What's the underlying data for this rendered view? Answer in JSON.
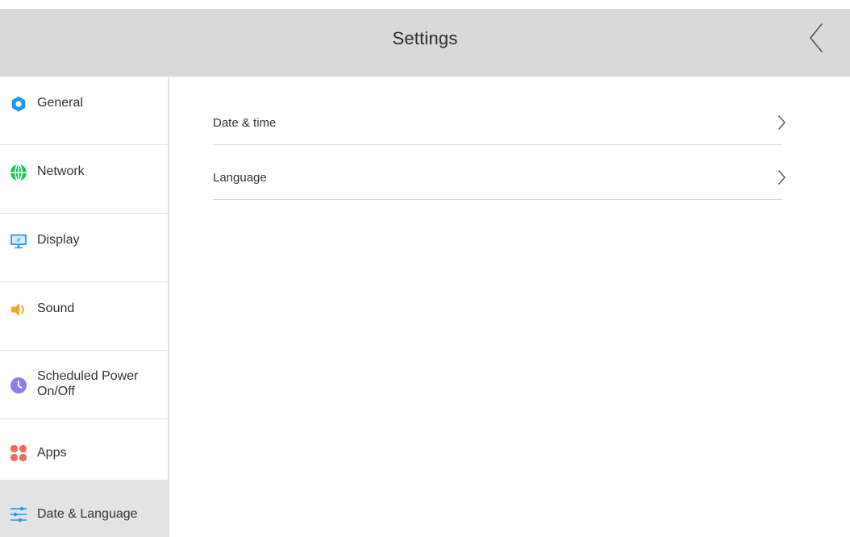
{
  "header": {
    "title": "Settings",
    "back_icon": "chevron-left-icon"
  },
  "sidebar": {
    "items": [
      {
        "label": "General",
        "icon": "gear-icon",
        "color": "#2196f3",
        "active": false
      },
      {
        "label": "Network",
        "icon": "globe-icon",
        "color": "#1ec25a",
        "active": false
      },
      {
        "label": "Display",
        "icon": "monitor-icon",
        "color": "#3aa0ea",
        "active": false
      },
      {
        "label": "Sound",
        "icon": "speaker-icon",
        "color": "#f5a623",
        "active": false
      },
      {
        "label": "Scheduled Power\nOn/Off",
        "icon": "clock-icon",
        "color": "#8f7cf0",
        "active": false
      },
      {
        "label": "Apps",
        "icon": "apps-icon",
        "color": "#f56a5b",
        "active": false
      },
      {
        "label": "Date & Language",
        "icon": "sliders-icon",
        "color": "#2196f3",
        "active": true
      }
    ]
  },
  "main": {
    "rows": [
      {
        "label": "Date & time",
        "icon": "chevron-right-icon"
      },
      {
        "label": "Language",
        "icon": "chevron-right-icon"
      }
    ]
  },
  "colors": {
    "header_bg": "#d9d9d9",
    "active_bg": "#e3e3e3",
    "divider": "#d6d6d6"
  }
}
